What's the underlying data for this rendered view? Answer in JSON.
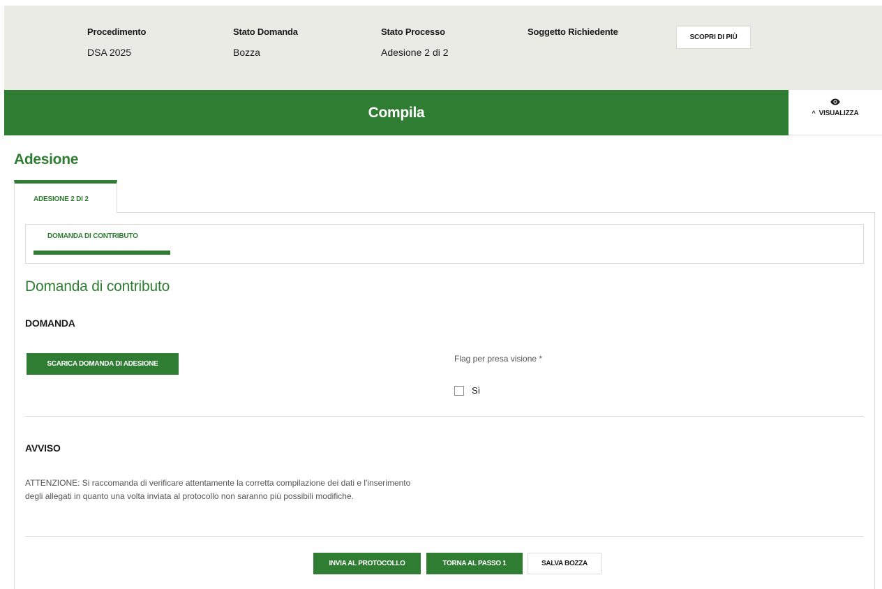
{
  "header": {
    "procedimento_label": "Procedimento",
    "procedimento_value": "DSA 2025",
    "stato_domanda_label": "Stato Domanda",
    "stato_domanda_value": "Bozza",
    "stato_processo_label": "Stato Processo",
    "stato_processo_value": "Adesione 2 di 2",
    "soggetto_label": "Soggetto Richiedente",
    "scopri_button": "SCOPRI DI PIÙ"
  },
  "banner": {
    "title": "Compila",
    "visualizza_label": "VISUALIZZA",
    "visualizza_icon": "eye-icon",
    "chevron_icon": "chevron-up-icon"
  },
  "page": {
    "section_title": "Adesione",
    "outer_tab_label": "ADESIONE 2 DI 2",
    "inner_tab_label": "DOMANDA DI CONTRIBUTO",
    "sub_title": "Domanda di contributo"
  },
  "domanda": {
    "heading": "DOMANDA",
    "download_button": "SCARICA DOMANDA DI ADESIONE",
    "flag_label": "Flag per presa visione *",
    "checkbox_label": "Sì",
    "checkbox_checked": false
  },
  "avviso": {
    "heading": "AVVISO",
    "text": "ATTENZIONE: Si raccomanda di verificare attentamente la corretta compilazione dei dati e l'inserimento degli allegati in quanto una volta inviata al protocollo non saranno più possibili modifiche."
  },
  "actions": {
    "invia": "INVIA AL PROTOCOLLO",
    "torna": "TORNA AL PASSO 1",
    "salva": "SALVA BOZZA"
  },
  "colors": {
    "primary_green": "#2e7d32",
    "header_background": "#ebebe6"
  }
}
